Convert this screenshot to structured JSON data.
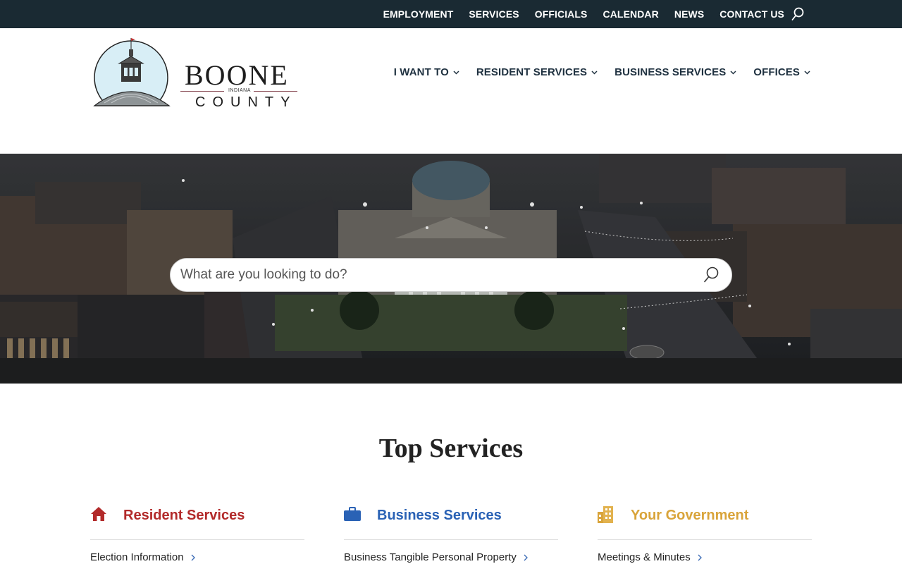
{
  "topbar": {
    "links": [
      "EMPLOYMENT",
      "SERVICES",
      "OFFICIALS",
      "CALENDAR",
      "NEWS",
      "CONTACT US"
    ]
  },
  "logo": {
    "name": "BOONE",
    "state": "INDIANA",
    "county": "COUNTY"
  },
  "mainnav": {
    "items": [
      "I WANT TO",
      "RESIDENT SERVICES",
      "BUSINESS SERVICES",
      "OFFICES"
    ]
  },
  "hero": {
    "search_placeholder": "What are you looking to do?"
  },
  "services": {
    "title": "Top Services",
    "columns": [
      {
        "title": "Resident Services",
        "icon": "house-icon",
        "color": "#b22a2a",
        "links": [
          "Election Information"
        ]
      },
      {
        "title": "Business Services",
        "icon": "briefcase-icon",
        "color": "#2a62b5",
        "links": [
          "Business Tangible Personal Property"
        ]
      },
      {
        "title": "Your Government",
        "icon": "building-icon",
        "color": "#d9a43a",
        "links": [
          "Meetings & Minutes"
        ]
      }
    ]
  },
  "colors": {
    "topbar": "#1a2a33",
    "nav_text": "#1f3140",
    "resident": "#b22a2a",
    "business": "#2a62b5",
    "government": "#d9a43a"
  }
}
